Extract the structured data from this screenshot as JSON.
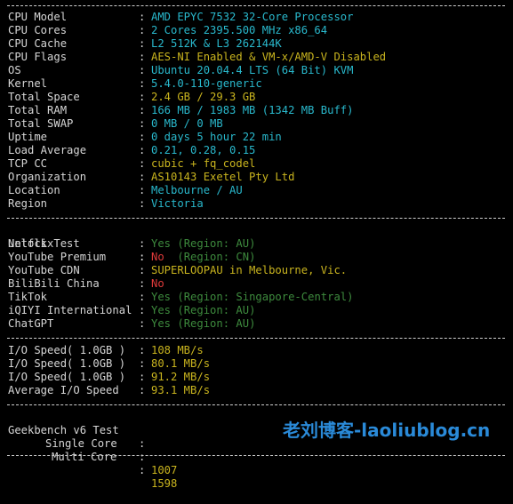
{
  "system": [
    {
      "label": "CPU Model",
      "value": "AMD EPYC 7532 32-Core Processor",
      "color": "cyan"
    },
    {
      "label": "CPU Cores",
      "value": "2 Cores 2395.500 MHz x86_64",
      "color": "cyan"
    },
    {
      "label": "CPU Cache",
      "value": "L2 512K & L3 262144K",
      "color": "cyan"
    },
    {
      "label": "CPU Flags",
      "value": "AES-NI Enabled & VM-x/AMD-V Disabled",
      "color": "yellow"
    },
    {
      "label": "OS",
      "value": "Ubuntu 20.04.4 LTS (64 Bit) KVM",
      "color": "cyan"
    },
    {
      "label": "Kernel",
      "value": "5.4.0-110-generic",
      "color": "cyan"
    },
    {
      "label": "Total Space",
      "value": "2.4 GB / 29.3 GB",
      "color": "yellow"
    },
    {
      "label": "Total RAM",
      "value": "166 MB / 1983 MB (1342 MB Buff)",
      "color": "cyan"
    },
    {
      "label": "Total SWAP",
      "value": "0 MB / 0 MB",
      "color": "cyan"
    },
    {
      "label": "Uptime",
      "value": "0 days 5 hour 22 min",
      "color": "cyan"
    },
    {
      "label": "Load Average",
      "value": "0.21, 0.28, 0.15",
      "color": "cyan"
    },
    {
      "label": "TCP CC",
      "value": "cubic + fq_codel",
      "color": "yellow"
    },
    {
      "label": "Organization",
      "value": "AS10143 Exetel Pty Ltd",
      "color": "yellow"
    },
    {
      "label": "Location",
      "value": "Melbourne / AU",
      "color": "cyan"
    },
    {
      "label": "Region",
      "value": "Victoria",
      "color": "cyan"
    }
  ],
  "unlock": {
    "title": "Unlock Test",
    "items": [
      {
        "label": "Netflix",
        "status": "Yes",
        "detail": " (Region: AU)",
        "status_color": "dim-green",
        "detail_color": "dim-green"
      },
      {
        "label": "YouTube Premium",
        "status": "No",
        "detail": "  (Region: CN)",
        "status_color": "red",
        "detail_color": "dim-green"
      },
      {
        "label": "YouTube CDN",
        "status": "SUPERLOOPAU in Melbourne, Vic.",
        "detail": "",
        "status_color": "yellow",
        "detail_color": "yellow"
      },
      {
        "label": "BiliBili China",
        "status": "No",
        "detail": "",
        "status_color": "red",
        "detail_color": "red"
      },
      {
        "label": "TikTok",
        "status": "Yes",
        "detail": " (Region: Singapore-Central)",
        "status_color": "dim-green",
        "detail_color": "dim-green"
      },
      {
        "label": "iQIYI International",
        "status": "Yes",
        "detail": " (Region: AU)",
        "status_color": "dim-green",
        "detail_color": "dim-green"
      },
      {
        "label": "ChatGPT",
        "status": "Yes",
        "detail": " (Region: AU)",
        "status_color": "dim-green",
        "detail_color": "dim-green"
      }
    ]
  },
  "io": [
    {
      "label": "I/O Speed( 1.0GB )",
      "value": "108 MB/s"
    },
    {
      "label": "I/O Speed( 1.0GB )",
      "value": "80.1 MB/s"
    },
    {
      "label": "I/O Speed( 1.0GB )",
      "value": "91.2 MB/s"
    },
    {
      "label": "Average I/O Speed",
      "value": "93.1 MB/s"
    }
  ],
  "geekbench": {
    "title": "Geekbench v6 Test",
    "single_label": "Single Core",
    "single_value": "1007",
    "multi_label": "Multi Core",
    "multi_value": "1598"
  },
  "watermark": "老刘博客-laoliublog.cn",
  "colors": {
    "cyan": "#29b8cc",
    "yellow": "#c9b41e",
    "green": "#3fb53f",
    "red": "#e03a3a",
    "text": "#d6d6d6",
    "background": "#000000",
    "watermark": "#2a8ad8"
  }
}
